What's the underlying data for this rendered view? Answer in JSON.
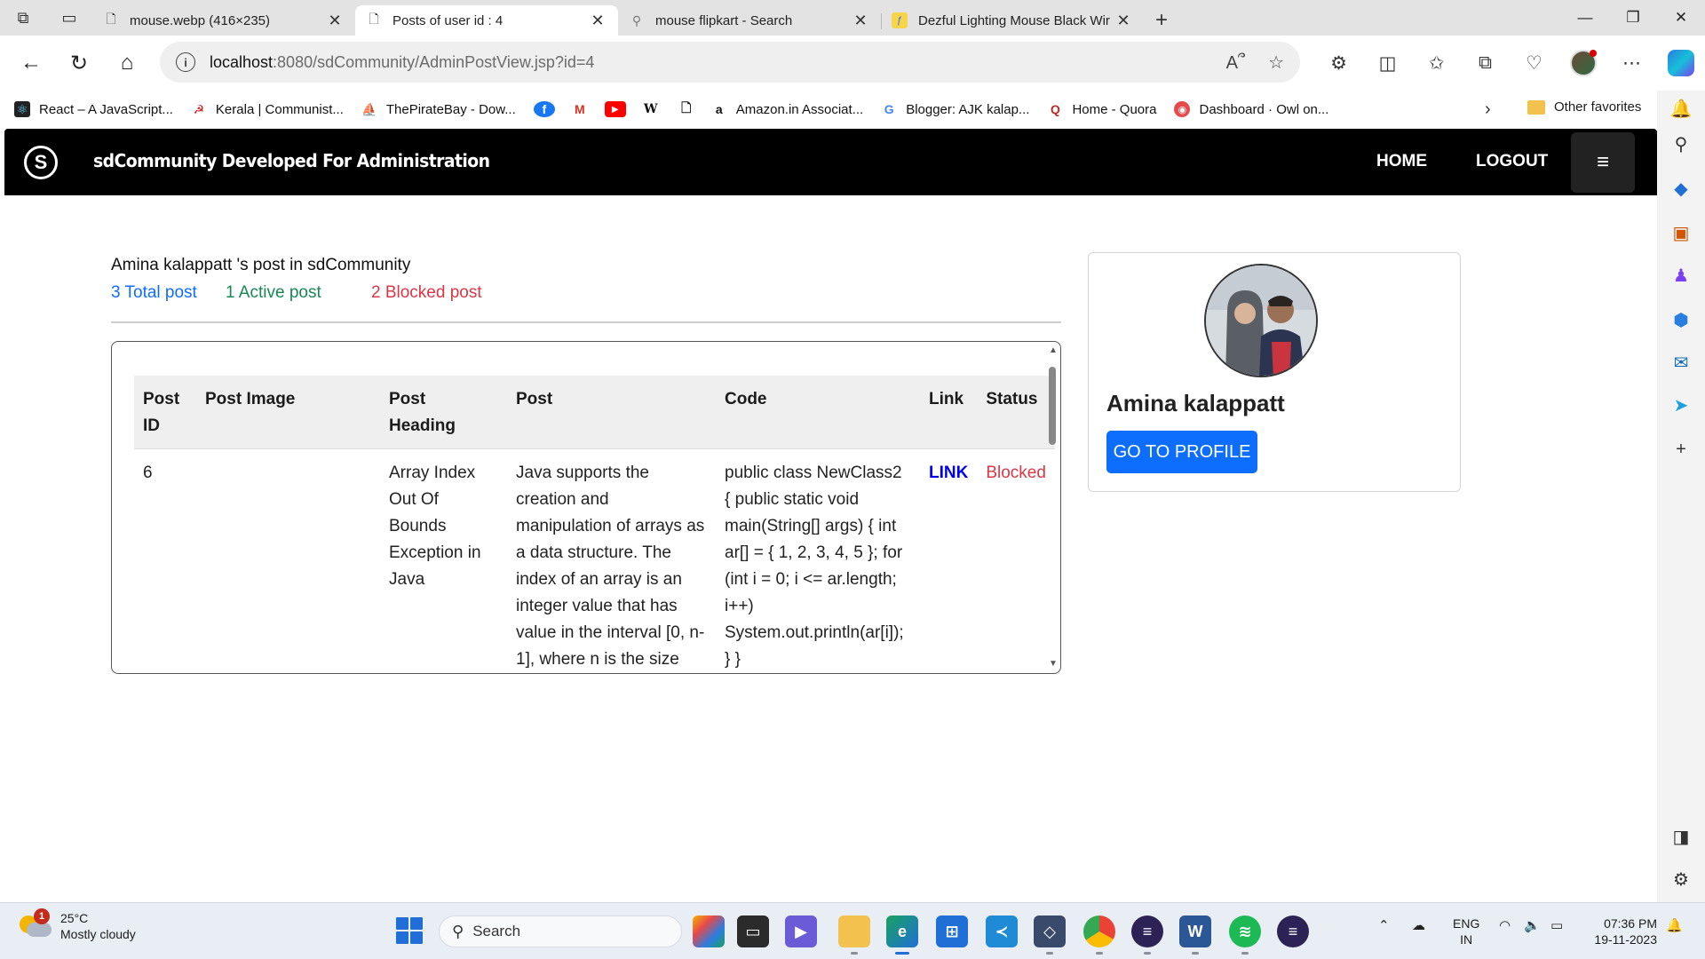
{
  "browser": {
    "tabs": [
      {
        "title": "mouse.webp (416×235)",
        "icon": "document-icon",
        "active": false
      },
      {
        "title": "Posts of user id : 4",
        "icon": "document-icon",
        "active": true
      },
      {
        "title": "mouse flipkart - Search",
        "icon": "search-icon",
        "active": false
      },
      {
        "title": "Dezful Lighting Mouse Black Wir",
        "icon": "flipkart-icon",
        "active": false
      }
    ],
    "url_host": "localhost",
    "url_path": ":8080/sdCommunity/AdminPostView.jsp?id=4",
    "favorites": [
      {
        "label": "React – A JavaScript...",
        "icon": "react-icon"
      },
      {
        "label": "Kerala | Communist...",
        "icon": "hammer-sickle-icon"
      },
      {
        "label": "ThePirateBay - Dow...",
        "icon": "pirate-ship-icon"
      },
      {
        "label": "",
        "icon": "facebook-icon"
      },
      {
        "label": "",
        "icon": "gmail-icon"
      },
      {
        "label": "",
        "icon": "youtube-icon"
      },
      {
        "label": "",
        "icon": "wikipedia-icon"
      },
      {
        "label": "",
        "icon": "document-icon"
      },
      {
        "label": "Amazon.in Associat...",
        "icon": "amazon-icon"
      },
      {
        "label": "Blogger: AJK kalap...",
        "icon": "google-icon"
      },
      {
        "label": "Home - Quora",
        "icon": "quora-icon"
      },
      {
        "label": "Dashboard · Owl on...",
        "icon": "owl-icon"
      }
    ],
    "other_favorites": "Other favorites"
  },
  "site": {
    "title": "sdCommunity Developed For Administration",
    "nav_home": "HOME",
    "nav_logout": "LOGOUT",
    "menu_icon": "≡"
  },
  "posts": {
    "owner_line": "Amina kalappatt 's post in sdCommunity",
    "total": "3 Total post",
    "active": "1 Active post",
    "blocked": "2 Blocked post",
    "columns": {
      "id": [
        "Post",
        "ID"
      ],
      "image": "Post Image",
      "heading": [
        "Post",
        "Heading"
      ],
      "post": "Post",
      "code": "Code",
      "link": "Link",
      "status": "Status"
    },
    "rows": [
      {
        "id": "6",
        "image": "",
        "heading": "Array Index Out Of Bounds Exception in Java",
        "post": "Java supports the creation and manipulation of arrays as a data structure. The index of an array is an integer value that has value in the interval [0, n-1], where n is the size",
        "code": "public class NewClass2 { public static void main(String[] args) { int ar[] = { 1, 2, 3, 4, 5 }; for (int i = 0; i <= ar.length; i++) System.out.println(ar[i]); } }",
        "link": "LINK",
        "status": "Blocked"
      }
    ]
  },
  "profile": {
    "name": "Amina kalappatt",
    "button": "GO TO PROFILE"
  },
  "taskbar": {
    "weather_temp": "25°C",
    "weather_desc": "Mostly cloudy",
    "weather_badge": "1",
    "search_placeholder": "Search",
    "lang_top": "ENG",
    "lang_bottom": "IN",
    "time": "07:36 PM",
    "date": "19-11-2023"
  },
  "colors": {
    "total": "#0d6efd",
    "active": "#198754",
    "blocked": "#dc3545",
    "primary_button": "#0d6efd",
    "navbar": "#000000"
  }
}
